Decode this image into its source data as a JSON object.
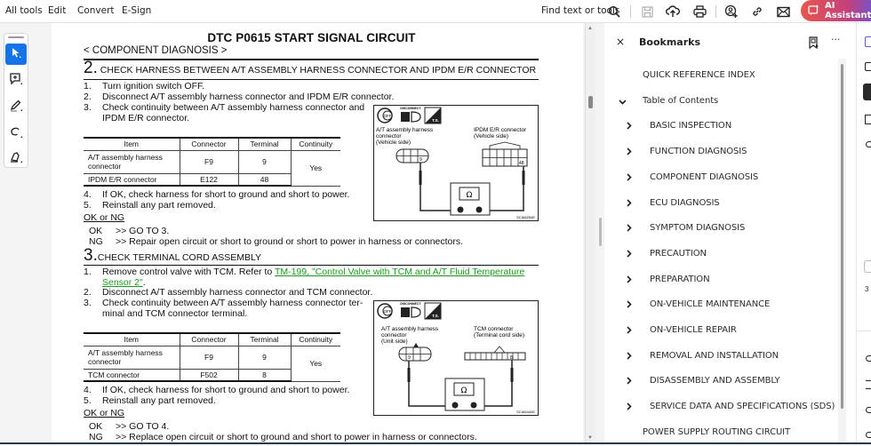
{
  "toolbar": {
    "menu": [
      "All tools",
      "Edit",
      "Convert",
      "E-Sign"
    ],
    "find_label": "Find text or tools",
    "icons": [
      "search-icon",
      "save-icon",
      "upload-cloud-icon",
      "print-icon",
      "share-user-icon",
      "link-icon",
      "mail-icon"
    ],
    "ai_label": "AI Assistant"
  },
  "left_tools": [
    "select-pointer-icon",
    "add-comment-icon",
    "highlight-pen-icon",
    "draw-lasso-icon",
    "fill-sign-icon"
  ],
  "document": {
    "title": "DTC P0615 START SIGNAL CIRCUIT",
    "breadcrumb": "< COMPONENT DIAGNOSIS >",
    "step2": {
      "num": "2.",
      "heading": "CHECK HARNESS BETWEEN A/T ASSEMBLY HARNESS CONNECTOR AND IPDM E/R CONNECTOR",
      "items": [
        {
          "n": "1.",
          "t": "Turn ignition switch OFF."
        },
        {
          "n": "2.",
          "t": "Disconnect A/T assembly harness connector and IPDM E/R connector."
        },
        {
          "n": "3.",
          "t": "Check continuity between A/T assembly harness connector and",
          "t2": "IPDM E/R connector."
        },
        {
          "n": "4.",
          "t": "If OK, check harness for short to ground and short to power."
        },
        {
          "n": "5.",
          "t": "Reinstall any part removed."
        }
      ],
      "table": {
        "headers": [
          "Item",
          "Connector",
          "Terminal",
          "Continuity"
        ],
        "rows": [
          {
            "item_a": "A/T assembly harness",
            "item_b": "connector",
            "connector": "F9",
            "terminal": "9"
          },
          {
            "item_a": "IPDM E/R connector",
            "item_b": "",
            "connector": "E122",
            "terminal": "48"
          }
        ],
        "continuity": "Yes"
      },
      "diagram": {
        "left_label": [
          "A/T assembly harness",
          "connector",
          "(Vehicle side)"
        ],
        "right_label": [
          "IPDM E/R connector",
          "(Vehicle side)"
        ],
        "left_pin": "9",
        "right_pin": "48",
        "meter": "Ω",
        "badge_disconnect": "DISCONNECT",
        "badge_off": "OFF",
        "badge_ts": "T.S.",
        "code": "SCIA8254E"
      },
      "okng": "OK or NG",
      "results": [
        {
          "k": "OK",
          "v": ">> GO TO 3."
        },
        {
          "k": "NG",
          "v": ">> Repair open circuit or short to ground or short to power in harness or connectors."
        }
      ]
    },
    "step3": {
      "num": "3.",
      "heading": "CHECK TERMINAL CORD ASSEMBLY",
      "items": [
        {
          "n": "1.",
          "t": "Remove control valve with TCM. Refer to ",
          "link": "TM-199, \"Control Valve with TCM and A/T Fluid Temperature",
          "link2": "Sensor 2\"",
          "tail": "."
        },
        {
          "n": "2.",
          "t": "Disconnect A/T assembly harness connector and TCM connector."
        },
        {
          "n": "3.",
          "t": "Check continuity between A/T assembly harness connector ter-",
          "t2": "minal and TCM connector terminal."
        },
        {
          "n": "4.",
          "t": "If OK, check harness for short to ground and short to power."
        },
        {
          "n": "5.",
          "t": "Reinstall any part removed."
        }
      ],
      "table": {
        "headers": [
          "Item",
          "Connector",
          "Terminal",
          "Continuity"
        ],
        "rows": [
          {
            "item_a": "A/T assembly harness",
            "item_b": "connector",
            "connector": "F9",
            "terminal": "9"
          },
          {
            "item_a": "TCM connector",
            "item_b": "",
            "connector": "F502",
            "terminal": "8"
          }
        ],
        "continuity": "Yes"
      },
      "diagram": {
        "left_label": [
          "A/T assembly harness",
          "connector",
          "(Unit side)"
        ],
        "right_label": [
          "TCM connector",
          "(Terminal cord side)"
        ],
        "left_pin": "9",
        "right_pin": "8",
        "meter": "Ω",
        "badge_disconnect": "DISCONNECT",
        "badge_off": "OFF",
        "badge_ts": "T.S.",
        "code": "SCIA5440E"
      },
      "okng": "OK or NG",
      "results": [
        {
          "k": "OK",
          "v": ">> GO TO 4."
        },
        {
          "k": "NG",
          "v": ">> Replace open circuit or short to ground and short to power in harness or connectors."
        }
      ]
    }
  },
  "bookmarks": {
    "title": "Bookmarks",
    "close": "×",
    "more": "···",
    "items": [
      {
        "label": "QUICK REFERENCE INDEX",
        "level": 0,
        "chevron": ""
      },
      {
        "label": "Table of Contents",
        "level": 0,
        "chevron": "expanded"
      },
      {
        "label": "BASIC INSPECTION",
        "level": 1,
        "chevron": "collapsed"
      },
      {
        "label": "FUNCTION DIAGNOSIS",
        "level": 1,
        "chevron": "collapsed"
      },
      {
        "label": "COMPONENT DIAGNOSIS",
        "level": 1,
        "chevron": "collapsed"
      },
      {
        "label": "ECU DIAGNOSIS",
        "level": 1,
        "chevron": "collapsed"
      },
      {
        "label": "SYMPTOM DIAGNOSIS",
        "level": 1,
        "chevron": "collapsed"
      },
      {
        "label": "PRECAUTION",
        "level": 1,
        "chevron": "collapsed"
      },
      {
        "label": "PREPARATION",
        "level": 1,
        "chevron": "collapsed"
      },
      {
        "label": "ON-VEHICLE MAINTENANCE",
        "level": 1,
        "chevron": "collapsed"
      },
      {
        "label": "ON-VEHICLE REPAIR",
        "level": 1,
        "chevron": "collapsed"
      },
      {
        "label": "REMOVAL AND INSTALLATION",
        "level": 1,
        "chevron": "collapsed"
      },
      {
        "label": "DISASSEMBLY AND ASSEMBLY",
        "level": 1,
        "chevron": "collapsed"
      },
      {
        "label": "SERVICE DATA AND SPECIFICATIONS (SDS)",
        "level": 1,
        "chevron": "collapsed"
      },
      {
        "label": "POWER SUPPLY ROUTING CIRCUIT",
        "level": 0,
        "chevron": ""
      }
    ]
  },
  "colors": {
    "accent": "#1473e6",
    "link": "#1a9a1a",
    "ai_gradient_start": "#e8574c",
    "ai_gradient_end": "#5b5be0"
  }
}
